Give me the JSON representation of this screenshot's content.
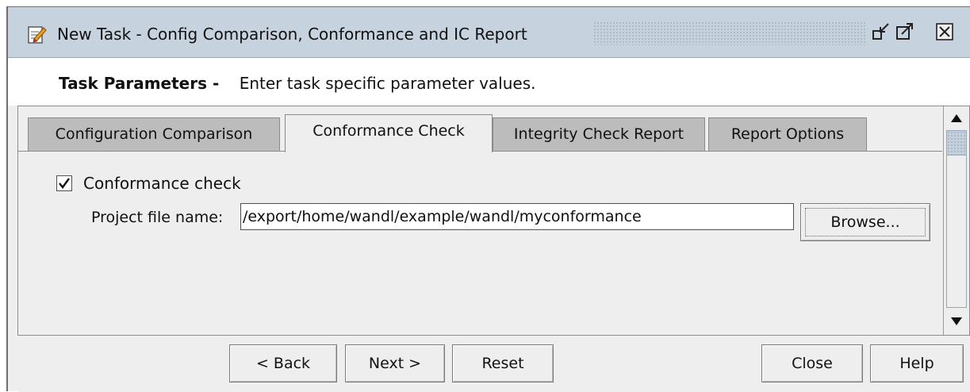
{
  "window": {
    "title": "New Task - Config Comparison, Conformance and IC Report",
    "icon": "task-icon",
    "controls": [
      "restore-icon",
      "maximize-icon",
      "close-icon"
    ]
  },
  "header": {
    "bold": "Task Parameters -",
    "description": "Enter task specific parameter values."
  },
  "tabs": [
    {
      "label": "Configuration Comparison",
      "active": false
    },
    {
      "label": "Conformance Check",
      "active": true
    },
    {
      "label": "Integrity Check Report",
      "active": false
    },
    {
      "label": "Report Options",
      "active": false
    }
  ],
  "conformance": {
    "checkbox_label": "Conformance check",
    "checked": true,
    "project_label": "Project file name:",
    "project_value": "/export/home/wandl/example/wandl/myconformance",
    "browse_label": "Browse..."
  },
  "footer": {
    "back": "< Back",
    "next": "Next >",
    "reset": "Reset",
    "close": "Close",
    "help": "Help"
  },
  "colors": {
    "titlebar": "#c7d2df",
    "panel": "#eeeeee",
    "inactive_tab": "#bcbcbc"
  }
}
